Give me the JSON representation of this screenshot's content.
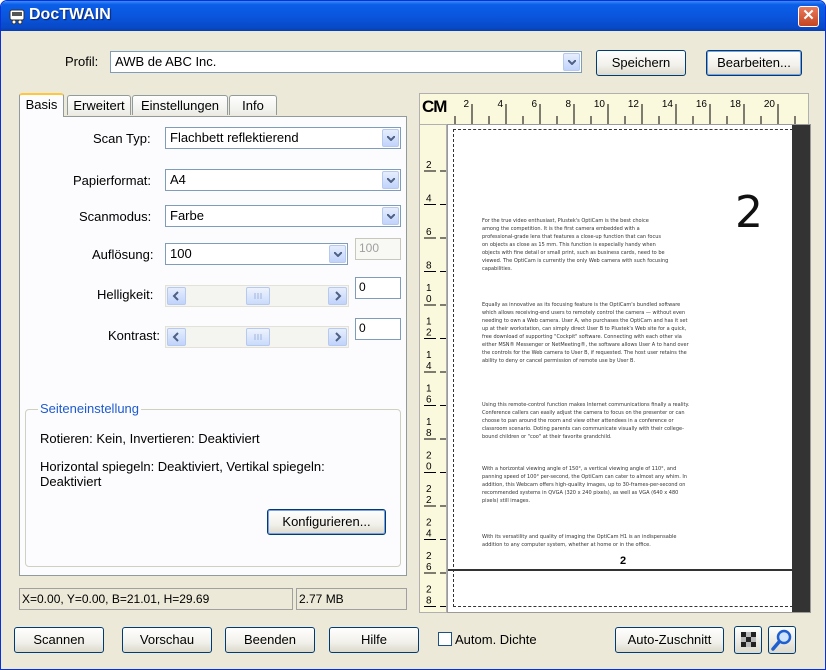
{
  "window": {
    "title": "DocTWAIN",
    "close_glyph": "✕"
  },
  "profile": {
    "label": "Profil:",
    "value": "AWB de ABC Inc.",
    "save_label": "Speichern",
    "edit_label": "Bearbeiten..."
  },
  "tabs": [
    {
      "label": "Basis"
    },
    {
      "label": "Erweitert"
    },
    {
      "label": "Einstellungen"
    },
    {
      "label": "Info"
    }
  ],
  "basis": {
    "scan_type": {
      "label": "Scan Typ:",
      "value": "Flachbett reflektierend"
    },
    "paper_format": {
      "label": "Papierformat:",
      "value": "A4"
    },
    "scan_mode": {
      "label": "Scanmodus:",
      "value": "Farbe"
    },
    "resolution": {
      "label": "Auflösung:",
      "value": "100",
      "box": "100"
    },
    "brightness": {
      "label": "Helligkeit:",
      "value": "0",
      "level": 0.5
    },
    "contrast": {
      "label": "Kontrast:",
      "value": "0",
      "level": 0.5
    }
  },
  "page_settings": {
    "title": "Seiteneinstellung",
    "rotate": "Rotieren: Kein, Invertieren: Deaktiviert",
    "mirror_line1": "Horizontal spiegeln: Deaktiviert, Vertikal spiegeln:",
    "mirror_line2": "Deaktiviert",
    "configure_label": "Konfigurieren..."
  },
  "status": {
    "coords": "X=0.00, Y=0.00, B=21.01, H=29.69",
    "size": "2.77 MB"
  },
  "ruler": {
    "unit": "CM",
    "top_ticks": [
      "2",
      "4",
      "6",
      "8",
      "10",
      "12",
      "14",
      "16",
      "18",
      "20"
    ],
    "left_ticks": [
      [
        "2"
      ],
      [
        "4"
      ],
      [
        "6"
      ],
      [
        "8"
      ],
      [
        "1",
        "0"
      ],
      [
        "1",
        "2"
      ],
      [
        "1",
        "4"
      ],
      [
        "1",
        "6"
      ],
      [
        "1",
        "8"
      ],
      [
        "2",
        "0"
      ],
      [
        "2",
        "2"
      ],
      [
        "2",
        "4"
      ],
      [
        "2",
        "6"
      ],
      [
        "2",
        "8"
      ]
    ]
  },
  "preview_doc": {
    "page_number": "2",
    "footer_number": "2",
    "paragraphs": [
      [
        "For the true video enthusiast, Plustek's OptiCam is the best choice",
        "among the competition.  It is the first camera embedded with a",
        "professional-grade lens that features a close-up function that can focus",
        "on objects as close as 15 mm.  This function is especially handy when",
        "objects with fine detail or small print, such as business cards, need to be",
        "viewed.  The OptiCam is currently the only Web camera with such focusing",
        "capabilities."
      ],
      [
        "Equally as innovative as its focusing feature is the OptiCam's bundled software",
        "which allows receiving-end users to remotely control the camera — without even",
        "needing to own a Web camera.  User A, who purchases the OptiCam and has it set",
        "up at their workstation, can simply direct User B to Plustek's Web site for a quick,",
        "free download of supporting \"Cockpit\" software.  Connecting with each other via",
        "either MSN® Messenger or NetMeeting®, the software allows User A to hand over",
        "the controls for the Web camera to User B, if requested.  The host user retains the",
        "ability to deny or cancel permission of remote use by User B."
      ],
      [
        "Using this remote-control function makes Internet communications finally a reality.",
        "Conference callers can easily adjust the camera to focus on the presenter or can",
        "choose to pan around the room and view other attendees in a conference or",
        "classroom scenario.  Doting parents can communicate visually with their college-",
        "bound children or \"coo\" at their favorite grandchild."
      ],
      [
        "With a horizontal viewing angle of 150°, a vertical viewing angle of 110°, and",
        "panning speed of 100° per-second, the OptiCam can cater to almost any whim.  In",
        "addition, this Webcam offers high-quality images, up to 30-frames-per-second on",
        "recommended systems in QVGA (320 x 240 pixels), as well as VGA (640 x 480",
        "pixels) still images."
      ],
      [
        "With its versatility and quality of imaging the OptiCam H1 is an indispensable",
        "addition to any computer system, whether at home or in the office."
      ]
    ]
  },
  "bottom": {
    "scan_label": "Scannen",
    "preview_label": "Vorschau",
    "exit_label": "Beenden",
    "help_label": "Hilfe",
    "auto_density_label": "Autom. Dichte",
    "auto_crop_label": "Auto-Zuschnitt"
  },
  "icons": {
    "app": "scanner-icon",
    "checker": "checkerboard-icon",
    "zoom": "magnifier-icon"
  },
  "colors": {
    "title_bar": "#0a56de",
    "group_title": "#1d5ad0",
    "tab_highlight": "#ffc83c"
  }
}
